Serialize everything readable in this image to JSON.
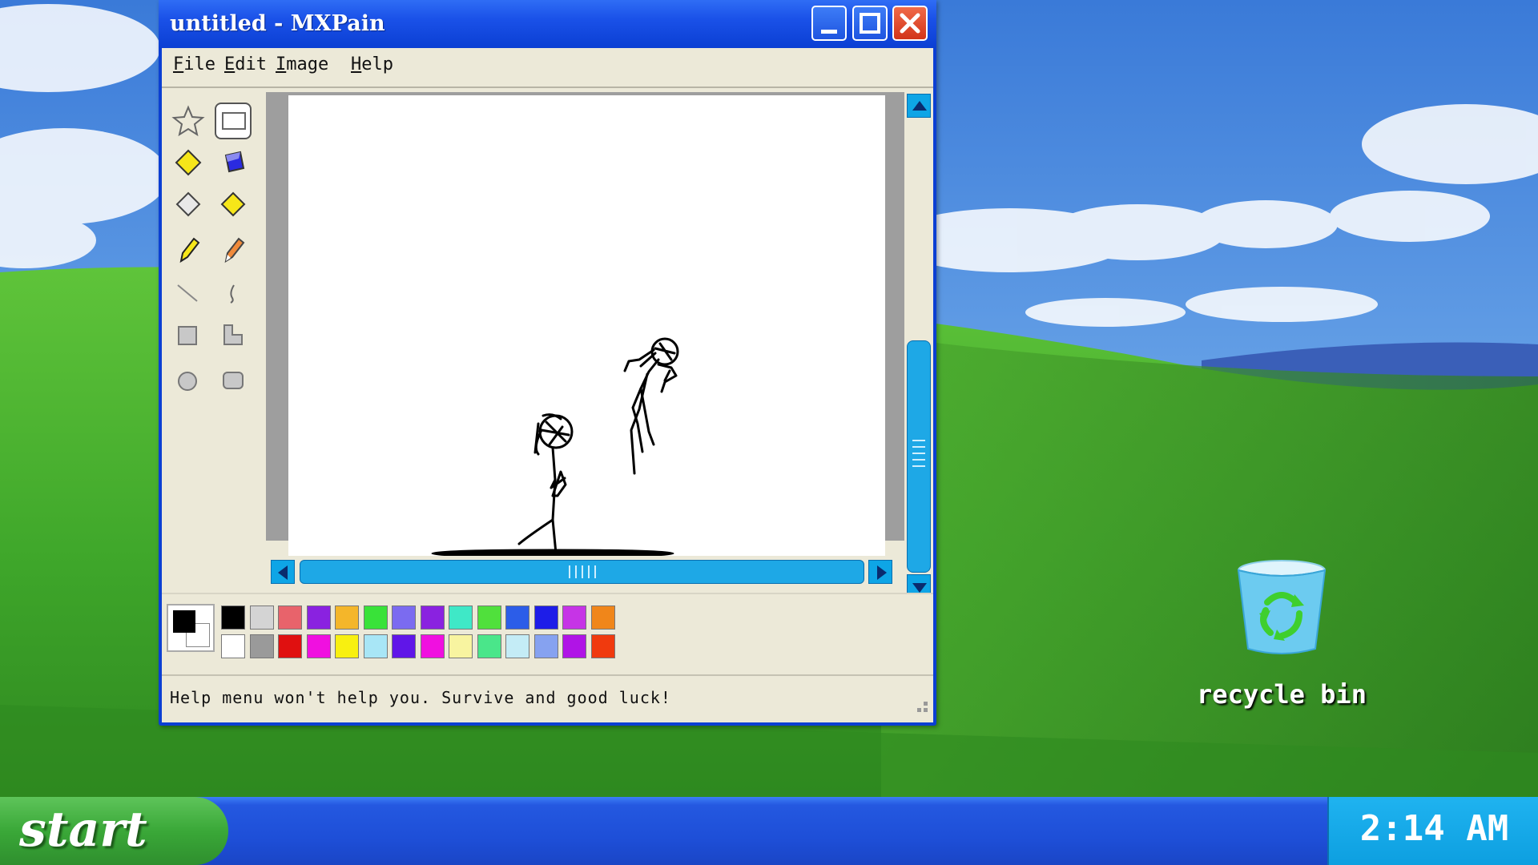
{
  "window": {
    "title": "untitled - MXPain",
    "menu": [
      "File",
      "Edit",
      "Image",
      "Help"
    ],
    "status": "Help menu won't help you. Survive and good luck!"
  },
  "tools": [
    "star-select-icon",
    "rect-select-icon",
    "fill-yellow-icon",
    "fill-blue-icon",
    "eraser-icon",
    "color-picker-icon",
    "pencil-icon",
    "brush-icon",
    "line-icon",
    "curve-icon",
    "rectangle-icon",
    "polygon-icon",
    "ellipse-icon",
    "rounded-rect-icon"
  ],
  "palette": {
    "current_fg": "#000000",
    "current_bg": "#ffffff",
    "row1": [
      "#000000",
      "#d4d4d4",
      "#e8636b",
      "#8a22e0",
      "#f4b62a",
      "#39e239",
      "#7b6bf0",
      "#8a22e0",
      "#3fe8c7",
      "#50e03c",
      "#2c5de8",
      "#1d1de8",
      "#c634e6",
      "#f0861a"
    ],
    "row2": [
      "#ffffff",
      "#9a9a9a",
      "#e01010",
      "#f010e0",
      "#f8f010",
      "#a8e6f6",
      "#6016e8",
      "#f010e0",
      "#f8f4a0",
      "#4ae68a",
      "#c4ecf6",
      "#86a2f0",
      "#b014e6",
      "#f03a0e"
    ]
  },
  "desktop": {
    "recycle_bin_label": "recycle bin"
  },
  "taskbar": {
    "start_label": "start",
    "clock": "2:14 AM"
  }
}
